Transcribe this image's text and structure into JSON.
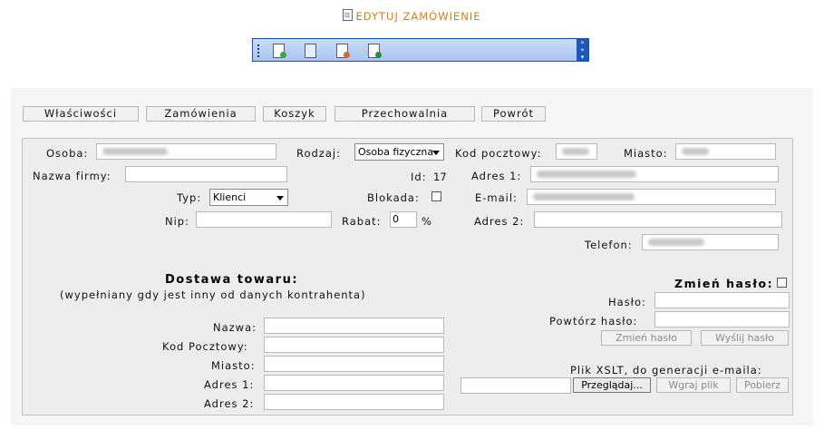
{
  "header": {
    "title": "EDYTUJ ZAMÓWIENIE"
  },
  "toolbar": {
    "buttons": [
      "new-doc-icon",
      "list-doc-icon",
      "delete-doc-icon",
      "save-doc-icon"
    ],
    "accent": "#1d4fa8"
  },
  "tabs": [
    "Właściwości",
    "Zamówienia",
    "Koszyk",
    "Przechowalnia",
    "Powrót"
  ],
  "form": {
    "osoba_label": "Osoba:",
    "rodzaj_label": "Rodzaj:",
    "rodzaj_value": "Osoba fizyczna",
    "kod_label": "Kod pocztowy:",
    "miasto_label": "Miasto:",
    "nazwa_firmy_label": "Nazwa firmy:",
    "id_label": "Id:",
    "id_value": "17",
    "adres1_label": "Adres 1:",
    "typ_label": "Typ:",
    "typ_value": "Klienci",
    "blokada_label": "Blokada:",
    "email_label": "E-mail:",
    "nip_label": "Nip:",
    "rabat_label": "Rabat:",
    "rabat_value": "0",
    "rabat_unit": "%",
    "adres2_label": "Adres 2:",
    "telefon_label": "Telefon:"
  },
  "delivery": {
    "title": "Dostawa towaru:",
    "subtitle": "(wypełniany gdy jest inny od danych kontrahenta)",
    "nazwa_label": "Nazwa:",
    "kod_label": "Kod Pocztowy:",
    "miasto_label": "Miasto:",
    "adres1_label": "Adres 1:",
    "adres2_label": "Adres 2:"
  },
  "password": {
    "title": "Zmień hasło:",
    "haslo_label": "Hasło:",
    "powtorz_label": "Powtórz hasło:",
    "change_button": "Zmień hasło",
    "send_button": "Wyślij hasło"
  },
  "xslt": {
    "label": "Plik XSLT, do generacji e-maila:",
    "browse_button": "Przeglądaj...",
    "upload_button": "Wgraj plik",
    "download_button": "Pobierz"
  }
}
